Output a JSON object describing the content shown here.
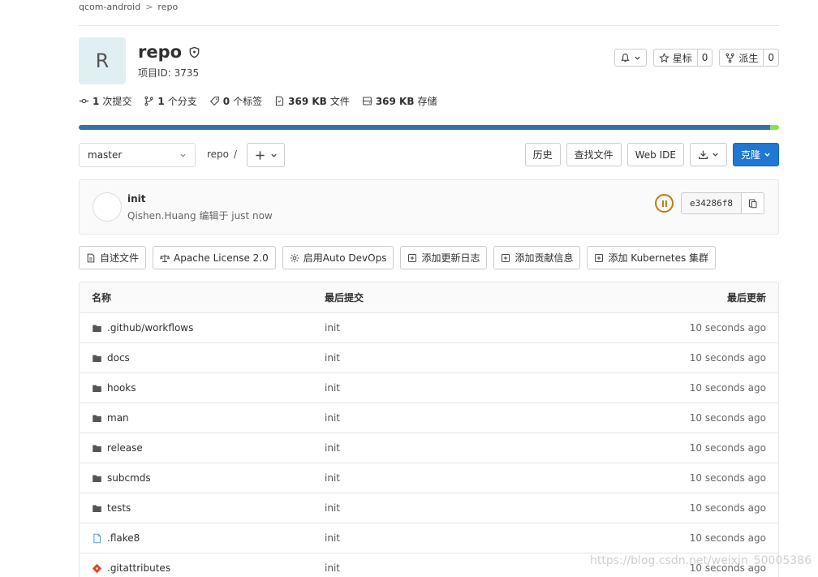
{
  "breadcrumb": {
    "group": "qcom-android",
    "separator": ">",
    "project": "repo"
  },
  "project": {
    "avatar_letter": "R",
    "name": "repo",
    "id_label": "项目ID: 3735"
  },
  "header_actions": {
    "star_label": "星标",
    "star_count": "0",
    "fork_label": "派生",
    "fork_count": "0"
  },
  "stats": {
    "commits_num": "1",
    "commits_label": "次提交",
    "branches_num": "1",
    "branches_label": "个分支",
    "tags_num": "0",
    "tags_label": "个标签",
    "files_size": "369 KB",
    "files_label": "文件",
    "storage_size": "369 KB",
    "storage_label": "存储"
  },
  "language_bar": {
    "primary_color": "#3572a5",
    "primary_pct": 98.7,
    "secondary_color": "#89e051",
    "secondary_pct": 1.3
  },
  "branch": {
    "current": "master"
  },
  "path": {
    "root": "repo",
    "sep": "/"
  },
  "repo_actions": {
    "history": "历史",
    "find_file": "查找文件",
    "web_ide": "Web IDE",
    "clone": "克隆"
  },
  "commit": {
    "title": "init",
    "meta": "Qishen.Huang 编辑于 just now",
    "sha": "e34286f8",
    "pipeline_status_color": "#c17d10"
  },
  "quick_actions": {
    "readme": "自述文件",
    "license": "Apache License 2.0",
    "auto_devops": "启用Auto DevOps",
    "changelog": "添加更新日志",
    "contributing": "添加贡献信息",
    "kubernetes": "添加 Kubernetes 集群"
  },
  "table": {
    "headers": {
      "name": "名称",
      "last_commit": "最后提交",
      "last_update": "最后更新"
    },
    "rows": [
      {
        "name": ".github/workflows",
        "type": "folder",
        "commit": "init",
        "updated": "10 seconds ago"
      },
      {
        "name": "docs",
        "type": "folder",
        "commit": "init",
        "updated": "10 seconds ago"
      },
      {
        "name": "hooks",
        "type": "folder",
        "commit": "init",
        "updated": "10 seconds ago"
      },
      {
        "name": "man",
        "type": "folder",
        "commit": "init",
        "updated": "10 seconds ago"
      },
      {
        "name": "release",
        "type": "folder",
        "commit": "init",
        "updated": "10 seconds ago"
      },
      {
        "name": "subcmds",
        "type": "folder",
        "commit": "init",
        "updated": "10 seconds ago"
      },
      {
        "name": "tests",
        "type": "folder",
        "commit": "init",
        "updated": "10 seconds ago"
      },
      {
        "name": ".flake8",
        "type": "file",
        "commit": "init",
        "updated": "10 seconds ago"
      },
      {
        "name": ".gitattributes",
        "type": "git-file",
        "commit": "init",
        "updated": "10 seconds ago"
      }
    ]
  },
  "watermark": "https://blog.csdn.net/weixin_50005386"
}
